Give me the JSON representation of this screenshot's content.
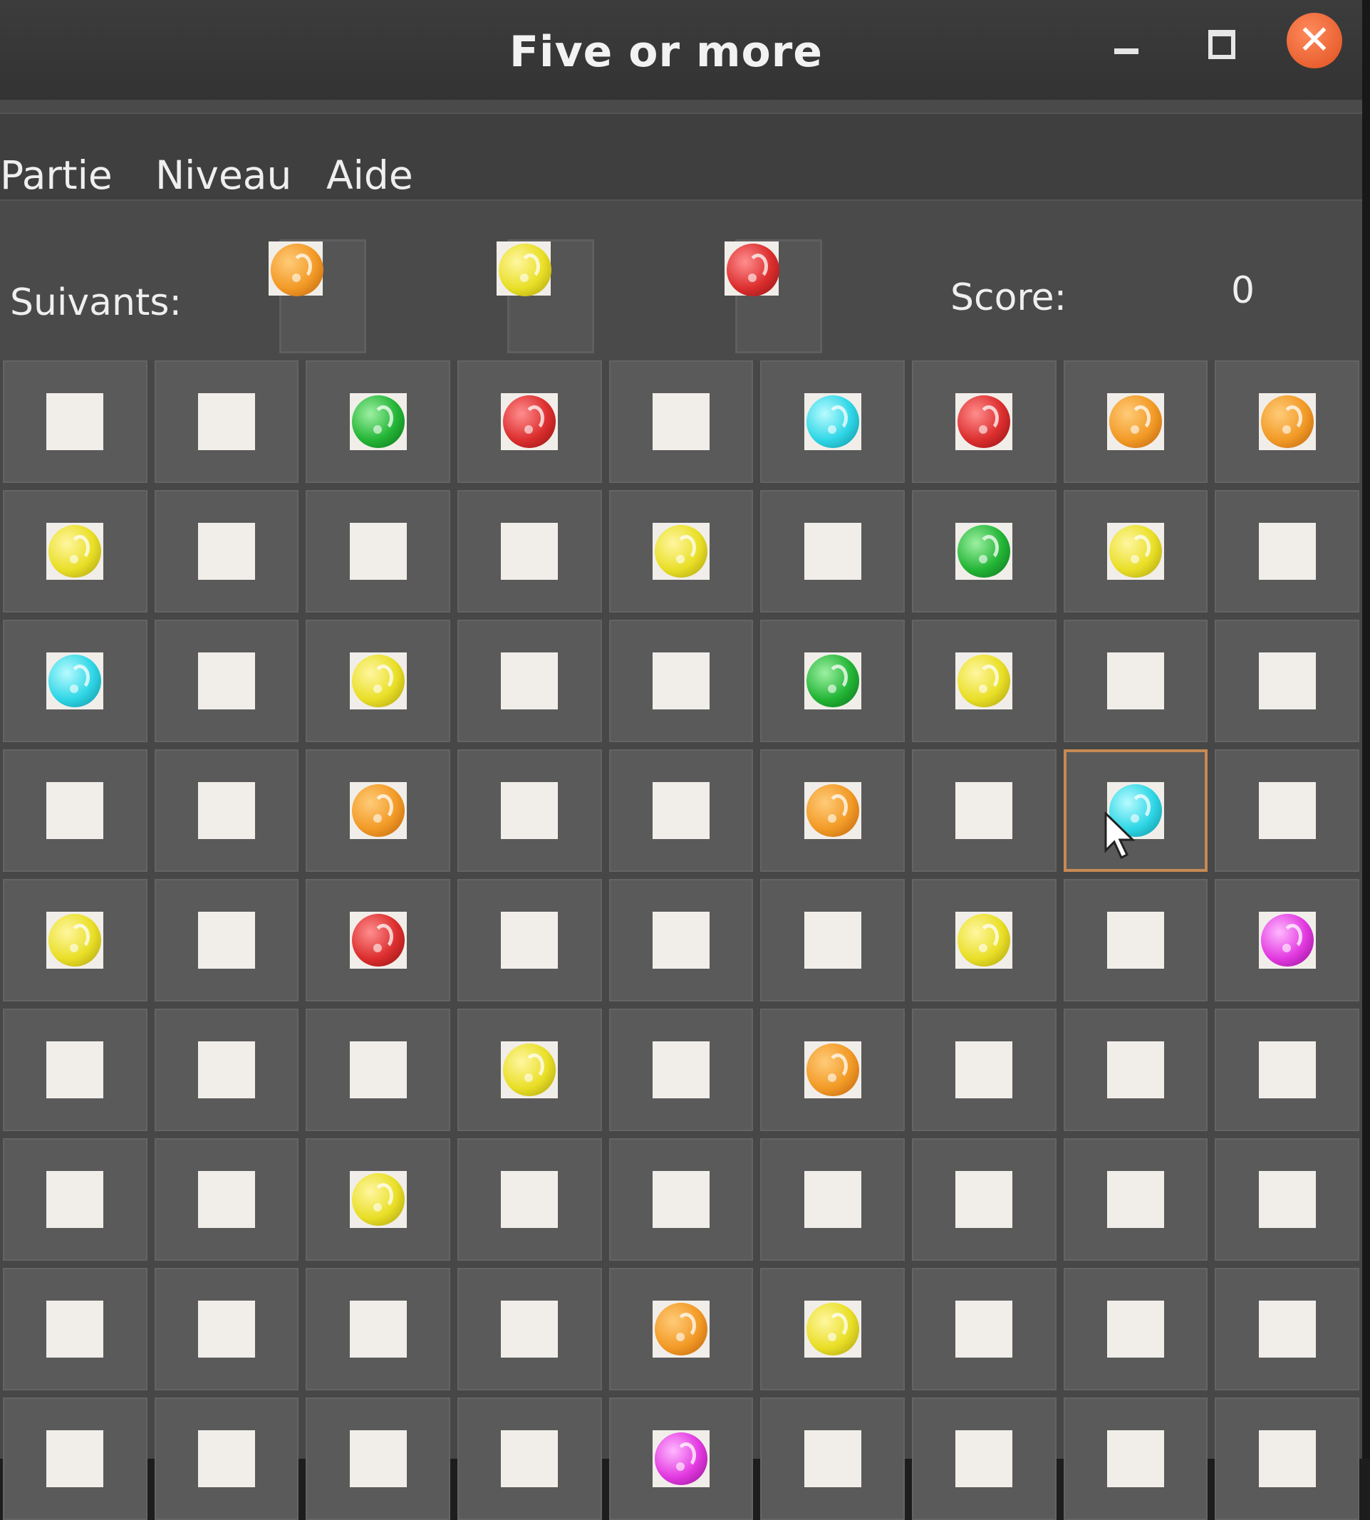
{
  "window": {
    "title": "Five or more"
  },
  "menu": [
    "Partie",
    "Niveau",
    "Aide"
  ],
  "toolbar": {
    "next_label": "Suivants:",
    "next_balls": [
      "orange",
      "yellow",
      "red"
    ],
    "score_label": "Score:",
    "score_value": "0"
  },
  "colors": {
    "orange": "#f29a26",
    "yellow": "#e9df27",
    "red": "#dc2e2e",
    "green": "#23b536",
    "cyan": "#2fd6e6",
    "magenta": "#e239e0",
    "close_button": "#e85a24",
    "selection_border": "#c78a52"
  },
  "board": {
    "rows": 9,
    "cols": 9,
    "selected_cell": [
      3,
      7
    ],
    "cells": [
      [
        "",
        "",
        "green",
        "red",
        "",
        "cyan",
        "red",
        "orange",
        "orange"
      ],
      [
        "yellow",
        "",
        "",
        "",
        "yellow",
        "",
        "green",
        "yellow",
        ""
      ],
      [
        "cyan",
        "",
        "yellow",
        "",
        "",
        "green",
        "yellow",
        "",
        ""
      ],
      [
        "",
        "",
        "orange",
        "",
        "",
        "orange",
        "",
        "cyan",
        ""
      ],
      [
        "yellow",
        "",
        "red",
        "",
        "",
        "",
        "yellow",
        "",
        "magenta"
      ],
      [
        "",
        "",
        "",
        "yellow",
        "",
        "orange",
        "",
        "",
        ""
      ],
      [
        "",
        "",
        "yellow",
        "",
        "",
        "",
        "",
        "",
        ""
      ],
      [
        "",
        "",
        "",
        "",
        "orange",
        "yellow",
        "",
        "",
        ""
      ],
      [
        "",
        "",
        "",
        "",
        "magenta",
        "",
        "",
        "",
        ""
      ]
    ]
  }
}
